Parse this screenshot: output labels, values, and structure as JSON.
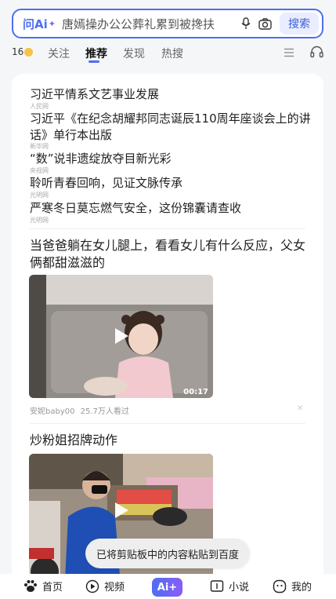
{
  "search": {
    "logo_text": "问Ai",
    "logo_spark": "✦",
    "query": "唐嫣操办公公葬礼累到被搀扶",
    "button_label": "搜索"
  },
  "weather": {
    "temp": "16"
  },
  "tabs": [
    {
      "label": "关注"
    },
    {
      "label": "推荐"
    },
    {
      "label": "发现"
    },
    {
      "label": "热搜"
    }
  ],
  "news": [
    {
      "title": "习近平情系文艺事业发展",
      "source": "人民网"
    },
    {
      "title": "习近平《在纪念胡耀邦同志诞辰110周年座谈会上的讲话》单行本出版",
      "source": "新华网"
    },
    {
      "title": "“数”说非遗绽放夺目新光彩",
      "source": "央视网"
    },
    {
      "title": "聆听青春回响，见证文脉传承",
      "source": "光明网"
    },
    {
      "title": "严寒冬日莫忘燃气安全，这份锦囊请查收",
      "source": "光明网"
    }
  ],
  "feed": [
    {
      "title": "当爸爸躺在女儿腿上，看看女儿有什么反应，父女俩都甜滋滋的",
      "duration": "00:17",
      "author": "安妮baby00",
      "views": "25.7万人看过",
      "close": "✕"
    },
    {
      "title": "炒粉姐招牌动作"
    }
  ],
  "toast": "已将剪贴板中的内容粘贴到百度",
  "nav": {
    "home": "首页",
    "video": "视频",
    "ai": "Ai+",
    "novel": "小说",
    "mine": "我的"
  },
  "colors": {
    "accent": "#4e6ef2",
    "ai_gradient_end": "#8a5cf6"
  }
}
